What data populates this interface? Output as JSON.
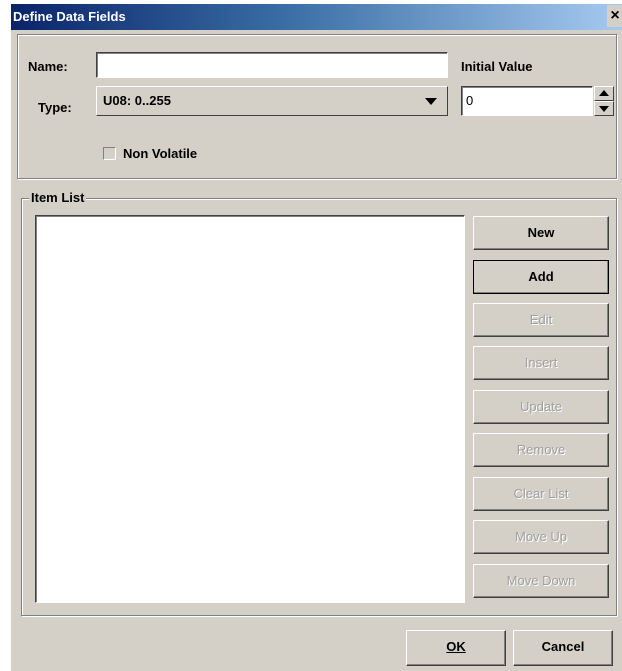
{
  "window": {
    "title": "Define Data Fields",
    "close_label": "×"
  },
  "fields": {
    "name_label": "Name:",
    "name_value": "",
    "type_label": "Type:",
    "type_value": "U08: 0..255",
    "initial_value_label": "Initial Value",
    "initial_value": "0",
    "non_volatile_label": "Non Volatile",
    "non_volatile_checked": false
  },
  "item_list": {
    "label": "Item List",
    "items": []
  },
  "side_buttons": [
    {
      "label": "New",
      "enabled": true
    },
    {
      "label": "Add",
      "enabled": true
    },
    {
      "label": "Edit",
      "enabled": false
    },
    {
      "label": "Insert",
      "enabled": false
    },
    {
      "label": "Update",
      "enabled": false
    },
    {
      "label": "Remove",
      "enabled": false
    },
    {
      "label": "Clear List",
      "enabled": false
    },
    {
      "label": "Move Up",
      "enabled": false
    },
    {
      "label": "Move Down",
      "enabled": false
    }
  ],
  "footer": {
    "ok_label": "OK",
    "cancel_label": "Cancel"
  }
}
